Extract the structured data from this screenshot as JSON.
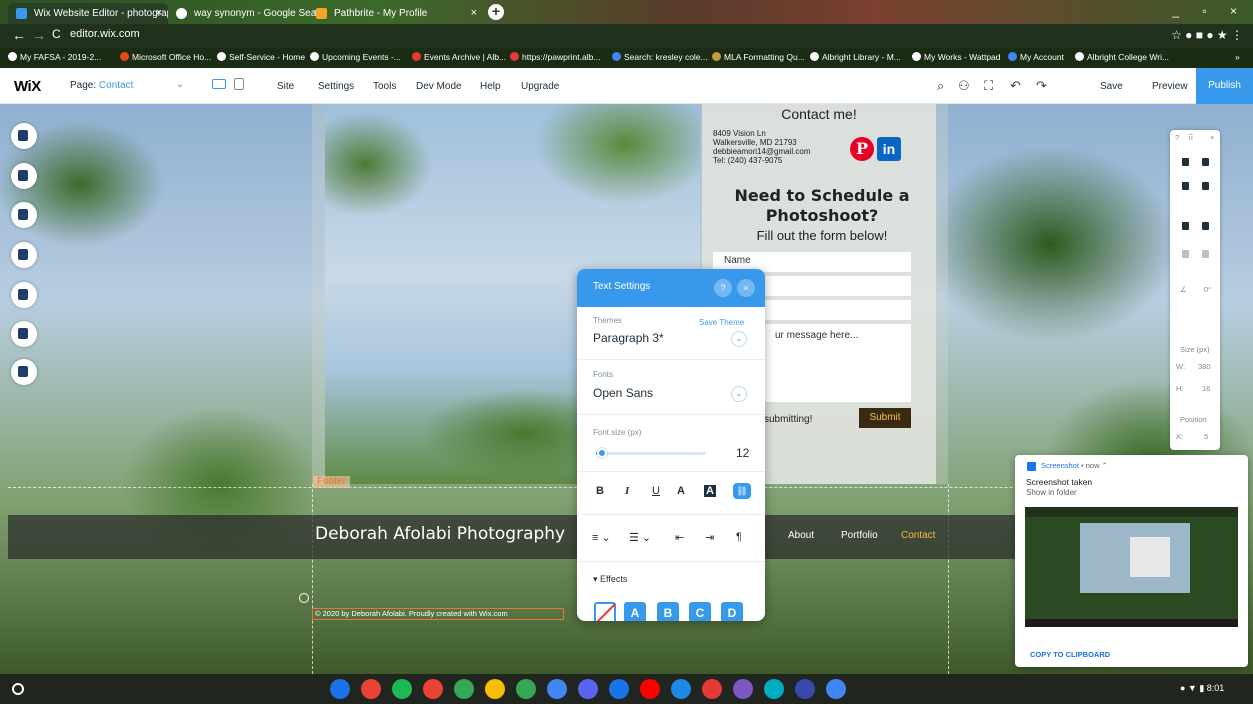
{
  "browser": {
    "tabs": [
      {
        "title": "Wix Website Editor - photography",
        "close": "×",
        "color": "#3899ec"
      },
      {
        "title": "way synonym - Google Search",
        "close": "×",
        "color": "#ffffff"
      },
      {
        "title": "Pathbrite - My Profile",
        "close": "×",
        "color": "#f4a623"
      }
    ],
    "new_tab": "+",
    "window_controls": "_ ▫ ×",
    "back": "←",
    "forward": "→",
    "reload": "C",
    "url": "editor.wix.com",
    "omni_right": "☆ ● ■ ● ★ ⋮",
    "bookmarks": [
      "My FAFSA - 2019-2...",
      "Microsoft Office Ho...",
      "Self-Service - Home",
      "Upcoming Events -...",
      "Events Archive | Alb...",
      "https://pawprint.alb...",
      "Search: kresley cole...",
      "MLA Formatting Qu...",
      "Albright Library - M...",
      "My Works - Wattpad",
      "My Account",
      "Albright College Wri...",
      "»"
    ]
  },
  "wix": {
    "logo": "WiX",
    "page_label": "Page:",
    "page_value": "Contact",
    "page_chevron": "⌄",
    "menu": [
      "Site",
      "Settings",
      "Tools",
      "Dev Mode",
      "Help",
      "Upgrade"
    ],
    "tool_icons": [
      "⌕",
      "⚇",
      "⛶",
      "↶",
      "↷"
    ],
    "save": "Save",
    "preview": "Preview",
    "publish": "Publish",
    "accent": "#3899ec"
  },
  "site": {
    "contact_title": "Contact me!",
    "address": [
      "8409 Vision Ln",
      "Walkersville, MD 21793",
      "debbieamori14@gmail.com",
      "Tel: (240) 437-9075"
    ],
    "pinterest": "P",
    "linkedin": "in",
    "schedule_heading": "Need to Schedule a Photoshoot?",
    "schedule_sub": "Fill out the form below!",
    "name_field": "Name",
    "message_field": "ur message here...",
    "thanks_text": "submitting!",
    "submit": "Submit",
    "footer_label": "Footer",
    "site_name": "Deborah Afolabi Photography",
    "nav": [
      "About",
      "Portfolio",
      "Contact"
    ],
    "copyright": "© 2020 by Deborah Afolabi. Proudly created with Wix.com"
  },
  "left_tools": [
    "pages-icon",
    "background-icon",
    "add-icon",
    "add-apps-icon",
    "media-icon",
    "blog-icon",
    "business-icon"
  ],
  "right_panel": {
    "help": "?",
    "grip": "⠿",
    "close": "×",
    "rotation_icon": "∠",
    "rotation": "0°",
    "size_label": "Size (px)",
    "w_label": "W:",
    "w_value": "380",
    "h_label": "H:",
    "h_value": "16",
    "position_label": "Position",
    "x_label": "X:",
    "x_value": "5"
  },
  "text_settings": {
    "title": "Text Settings",
    "help": "?",
    "close": "×",
    "themes_label": "Themes",
    "save_theme": "Save Theme",
    "theme_value": "Paragraph 3*",
    "fonts_label": "Fonts",
    "font_value": "Open Sans",
    "chevron": "⌄",
    "font_size_label": "Font size (px)",
    "font_size_value": "12",
    "font_size_fraction": 0.05,
    "format_buttons": [
      "B",
      "I",
      "U",
      "A",
      "A"
    ],
    "link_icon": "⛓",
    "align_buttons": [
      "≡ ⌄",
      "☰ ⌄",
      "⇤",
      "⇥",
      "¶"
    ],
    "effects_label": "Effects",
    "effects_arrow": "▾",
    "effects": [
      "A",
      "B",
      "C",
      "D"
    ]
  },
  "notification": {
    "app": "Screenshot",
    "time": "• now ⌃",
    "title": "Screenshot taken",
    "body": "Show in folder",
    "action": "COPY TO CLIPBOARD"
  },
  "shelf": {
    "apps": [
      "#1a73e8",
      "#ea4335",
      "#1db954",
      "#ea4335",
      "#34a853",
      "#fbbc04",
      "#34a853",
      "#4285f4",
      "#5865f2",
      "#1a73e8",
      "#ff0000",
      "#1e88e5",
      "#e53935",
      "#7e57c2",
      "#00acc1",
      "#3949ab",
      "#4285f4"
    ],
    "status": "● ▼ ▮ 8:01"
  }
}
